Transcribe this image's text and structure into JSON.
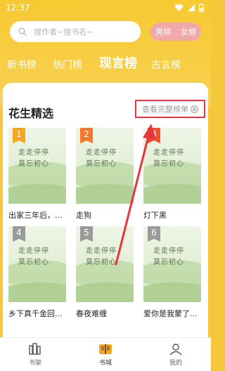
{
  "status_bar": {
    "time": "12:37"
  },
  "search": {
    "placeholder": "搜作者~搜书名~"
  },
  "gender": {
    "male": "男频",
    "female": "女频"
  },
  "rank_tabs": [
    "新书榜",
    "热门榜",
    "现言榜",
    "古言榜"
  ],
  "rank_tab_active_index": 2,
  "section": {
    "title": "花生精选",
    "full_list_link": "查看完整榜单"
  },
  "cover_art": {
    "calligraphy": "走走停停 莫忘初心"
  },
  "books": [
    {
      "rank": "1",
      "title": "出家三年后，..."
    },
    {
      "rank": "2",
      "title": "走狗"
    },
    {
      "rank": "3",
      "title": "灯下黑"
    },
    {
      "rank": "4",
      "title": "乡下真千金回..."
    },
    {
      "rank": "5",
      "title": "春夜难缠"
    },
    {
      "rank": "6",
      "title": "爱你是我蒙了..."
    }
  ],
  "bottom_nav": [
    {
      "label": "书架",
      "icon": "bookshelf-icon"
    },
    {
      "label": "书城",
      "icon": "bookstore-icon"
    },
    {
      "label": "我的",
      "icon": "profile-icon"
    }
  ],
  "bottom_nav_active_index": 1,
  "colors": {
    "header_yellow": "#f7c932",
    "highlight_red": "#e8343a",
    "gender_pink": "#f0a8a8",
    "badge_gold": "#f5a623",
    "badge_orange": "#f2792c",
    "badge_red": "#e8542b",
    "badge_gray": "#9b9b9b"
  }
}
